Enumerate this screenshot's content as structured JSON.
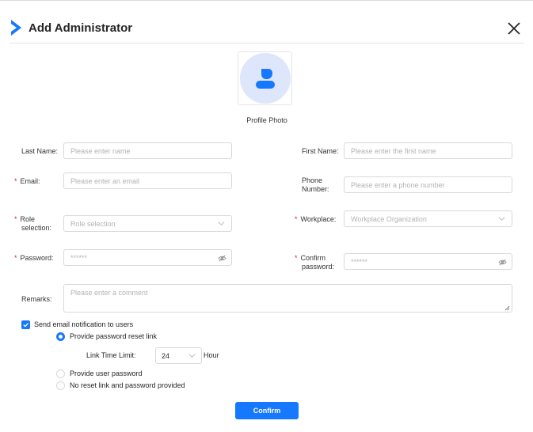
{
  "dialog": {
    "title": "Add Administrator",
    "brand_color": "#1677ff"
  },
  "photo": {
    "caption": "Profile Photo"
  },
  "form": {
    "last_name": {
      "label": "Last Name:",
      "placeholder": "Please enter name"
    },
    "first_name": {
      "label": "First Name:",
      "placeholder": "Please enter the first name"
    },
    "email": {
      "label": "Email:",
      "placeholder": "Please enter an email",
      "required": true
    },
    "phone": {
      "label_line1": "Phone",
      "label_line2": "Number:",
      "placeholder": "Please enter a phone number"
    },
    "role": {
      "label_line1": "Role",
      "label_line2": "selection:",
      "placeholder": "Role selection",
      "required": true
    },
    "workplace": {
      "label": "Workplace:",
      "placeholder": "Workplace Organization",
      "required": true
    },
    "password": {
      "label": "Password:",
      "placeholder": "******",
      "required": true
    },
    "confirm_password": {
      "label_line1": "Confirm",
      "label_line2": "password:",
      "placeholder": "******",
      "required": true
    },
    "remarks": {
      "label": "Remarks:",
      "placeholder": "Please enter a comment"
    }
  },
  "notification": {
    "checkbox_label": "Send email notification to users",
    "checked": true,
    "options": [
      {
        "label": "Provide password reset link",
        "selected": true
      },
      {
        "label": "Provide user password",
        "selected": false
      },
      {
        "label": "No reset link and password provided",
        "selected": false
      }
    ],
    "link_time": {
      "label": "Link Time Limit:",
      "value": "24",
      "unit": "Hour"
    }
  },
  "actions": {
    "confirm_label": "Confirm"
  },
  "required_mark": "*"
}
